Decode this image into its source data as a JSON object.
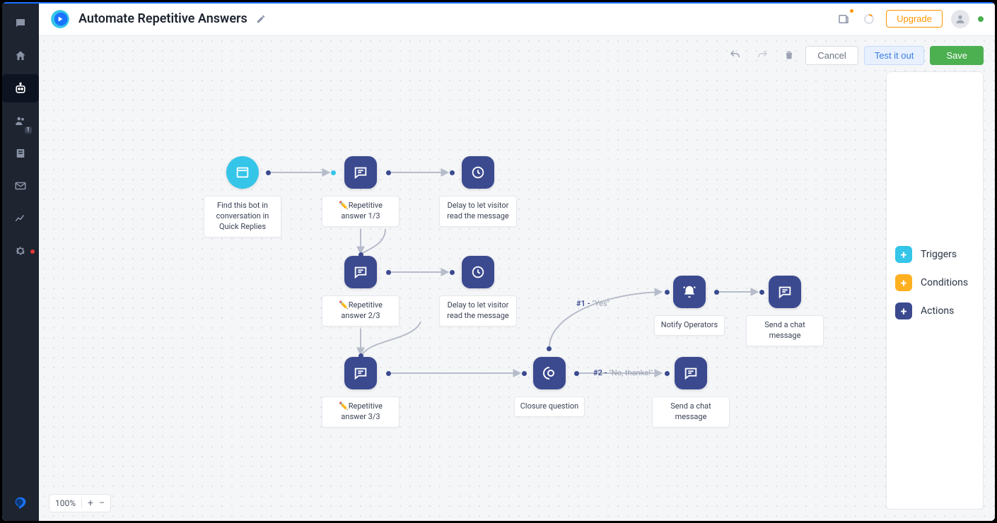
{
  "header": {
    "title": "Automate Repetitive Answers",
    "upgrade_label": "Upgrade"
  },
  "toolbar": {
    "cancel_label": "Cancel",
    "test_label": "Test it out",
    "save_label": "Save"
  },
  "legend": {
    "triggers": "Triggers",
    "conditions": "Conditions",
    "actions": "Actions"
  },
  "zoom": {
    "level": "100%"
  },
  "nodes": {
    "start": {
      "label": "Find this bot in conversation in Quick Replies"
    },
    "rep1": {
      "label": "✏️Repetitive answer 1/3"
    },
    "delay1": {
      "label": "Delay to let visitor read the message"
    },
    "rep2": {
      "label": "✏️Repetitive answer 2/3"
    },
    "delay2": {
      "label": "Delay to let visitor read the message"
    },
    "rep3": {
      "label": "✏️Repetitive answer 3/3"
    },
    "closure": {
      "label": "Closure question"
    },
    "notify": {
      "label": "Notify Operators"
    },
    "chat_yes": {
      "label": "Send a chat message"
    },
    "chat_no": {
      "label": "Send a chat message"
    }
  },
  "edge_labels": {
    "yes_num": "#1 - ",
    "yes_txt": "\"Yes\"",
    "no_num": "#2 - ",
    "no_txt": "\"No, thanks!\""
  },
  "sidebar": {
    "users_badge": "1"
  }
}
